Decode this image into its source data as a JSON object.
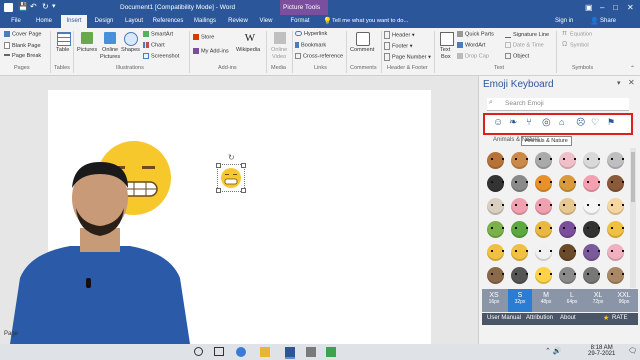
{
  "titlebar": {
    "doc_title": "Document1 [Compatibility Mode] - Word",
    "context_label": "Picture Tools",
    "tell_me": "Tell me what you want to do...",
    "sign_in": "Sign in",
    "share": "Share"
  },
  "tabs": [
    "File",
    "Home",
    "Insert",
    "Design",
    "Layout",
    "References",
    "Mailings",
    "Review",
    "View",
    "Format"
  ],
  "ribbon": {
    "pages": {
      "items": [
        "Cover Page",
        "Blank Page",
        "Page Break"
      ],
      "group": "Pages"
    },
    "tables": {
      "label": "Table",
      "group": "Tables"
    },
    "illustrations": {
      "pictures": "Pictures",
      "online_pictures_1": "Online",
      "online_pictures_2": "Pictures",
      "shapes": "Shapes",
      "smartart": "SmartArt",
      "chart": "Chart",
      "screenshot": "Screenshot",
      "group": "Illustrations"
    },
    "addins": {
      "store": "Store",
      "my_addins": "My Add-ins",
      "wikipedia": "Wikipedia",
      "group": "Add-ins"
    },
    "media": {
      "online_video_1": "Online",
      "online_video_2": "Video",
      "group": "Media"
    },
    "links": {
      "hyperlink": "Hyperlink",
      "bookmark": "Bookmark",
      "cross_reference": "Cross-reference",
      "group": "Links"
    },
    "comments": {
      "comment": "Comment",
      "group": "Comments"
    },
    "header_footer": {
      "header": "Header",
      "footer": "Footer",
      "page_number": "Page Number",
      "group": "Header & Footer"
    },
    "text": {
      "text_box_1": "Text",
      "text_box_2": "Box",
      "quick_parts": "Quick Parts",
      "wordart": "WordArt",
      "drop_cap": "Drop Cap",
      "signature_line": "Signature Line",
      "date_time": "Date & Time",
      "object": "Object",
      "group": "Text"
    },
    "symbols": {
      "equation": "Equation",
      "symbol": "Symbol",
      "group": "Symbols"
    }
  },
  "pane": {
    "title": "Emoji Keyboard",
    "search_placeholder": "Search Emoji",
    "category_label": "Animals & Nature",
    "tooltip": "Animals & Nature",
    "sizes": [
      {
        "label": "XS",
        "px": "16px"
      },
      {
        "label": "S",
        "px": "32px"
      },
      {
        "label": "M",
        "px": "48px"
      },
      {
        "label": "L",
        "px": "64px"
      },
      {
        "label": "XL",
        "px": "72px"
      },
      {
        "label": "XXL",
        "px": "96px"
      }
    ],
    "selected_size": "S",
    "extra_size_label": "32px",
    "footer": {
      "manual": "User Manual",
      "attribution": "Attribution",
      "about": "About",
      "rate": "RATE"
    }
  },
  "page_indicator": "Page",
  "taskbar": {
    "time": "8:18 AM",
    "date": "29-7-2021"
  },
  "emoji_grid_colors": [
    [
      "#b5733a",
      "#c98a4b",
      "#aaaaaa",
      "#f0c0c8",
      "#d9d9d9",
      "#bfbfbf"
    ],
    [
      "#333333",
      "#8a8a8a",
      "#e8902a",
      "#d99a3a",
      "#f5a0b0",
      "#8a5a3a"
    ],
    [
      "#d9cfc0",
      "#f0a0b0",
      "#f0a0b0",
      "#e6c890",
      "#f5f5f5",
      "#f5d5a0"
    ],
    [
      "#7bb04a",
      "#5da840",
      "#e8b840",
      "#7a4e9a",
      "#333333",
      "#f0c040"
    ],
    [
      "#f0c040",
      "#f0c040",
      "#f0f0f0",
      "#6b4a2a",
      "#7a5a9a",
      "#f0b0c0"
    ],
    [
      "#8a6a4a",
      "#555555",
      "#ffd24a",
      "#8a8a8a",
      "#777777",
      "#aa8866"
    ]
  ],
  "colors": {
    "word_blue": "#2b579a",
    "highlight_red": "#e01e1e",
    "size_selected": "#2b7cd3"
  }
}
